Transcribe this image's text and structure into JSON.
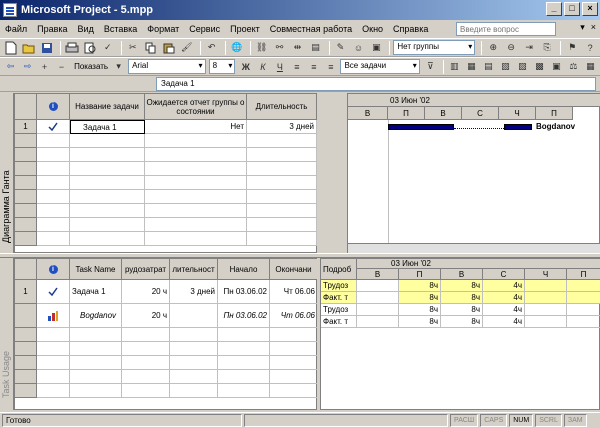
{
  "window": {
    "title": "Microsoft Project - 5.mpp",
    "controls": [
      "_",
      "□",
      "×"
    ]
  },
  "menu": {
    "items": [
      "Файл",
      "Правка",
      "Вид",
      "Вставка",
      "Формат",
      "Сервис",
      "Проект",
      "Совместная работа",
      "Окно",
      "Справка"
    ],
    "help_placeholder": "Введите вопрос",
    "doc_controls": [
      "▾",
      "×"
    ]
  },
  "toolbar1": {
    "group_combo": "Нет группы"
  },
  "toolbar2": {
    "show_label": "Показать",
    "font": "Arial",
    "size": "8",
    "bold": "Ж",
    "italic": "К",
    "underline": "Ч",
    "filter": "Все задачи"
  },
  "editbar": {
    "value": "Задача 1"
  },
  "gantt": {
    "side_label": "Диаграмма Ганта",
    "headers": [
      "",
      "Название задачи",
      "Ожидается отчет группы о состоянии",
      "Длительность"
    ],
    "row": {
      "id": "1",
      "name": "Задача 1",
      "report": "Нет",
      "duration": "3 дней"
    },
    "week": "03 Июн '02",
    "days": [
      "В",
      "П",
      "В",
      "С",
      "Ч",
      "П"
    ],
    "bar_label": "Bogdanov"
  },
  "usage": {
    "side_label": "Task Usage",
    "headers": [
      "",
      "Task Name",
      "рудозатрат",
      "лительност",
      "Начало",
      "Окончани"
    ],
    "rows": [
      {
        "id": "1",
        "name": "Задача 1",
        "work": "20 ч",
        "dur": "3 дней",
        "start": "Пн 03.06.02",
        "finish": "Чт 06.06"
      },
      {
        "id": "",
        "name": "Bogdanov",
        "work": "20 ч",
        "dur": "",
        "start": "Пн 03.06.02",
        "finish": "Чт 06.06"
      }
    ],
    "detail_header": "Подроб",
    "week": "03 Июн '02",
    "days": [
      "В",
      "П",
      "В",
      "С",
      "Ч",
      "П"
    ],
    "detail_rows": [
      {
        "label": "Трудоз",
        "values": [
          "",
          "8ч",
          "8ч",
          "4ч",
          ""
        ],
        "yellow": true
      },
      {
        "label": "Факт. т",
        "values": [
          "",
          "8ч",
          "8ч",
          "4ч",
          ""
        ],
        "yellow": true
      },
      {
        "label": "Трудоз",
        "values": [
          "",
          "8ч",
          "8ч",
          "4ч",
          ""
        ],
        "yellow": false
      },
      {
        "label": "Факт. т",
        "values": [
          "",
          "8ч",
          "8ч",
          "4ч",
          ""
        ],
        "yellow": false
      }
    ]
  },
  "status": {
    "text": "Готово",
    "indicators": [
      "РАСШ",
      "CAPS",
      "NUM",
      "SCRL",
      "ЗАМ"
    ],
    "active": "NUM"
  },
  "colors": {
    "title_start": "#0a246a",
    "title_end": "#a6caf0",
    "bar": "#000080",
    "yellow": "#ffffa0"
  }
}
